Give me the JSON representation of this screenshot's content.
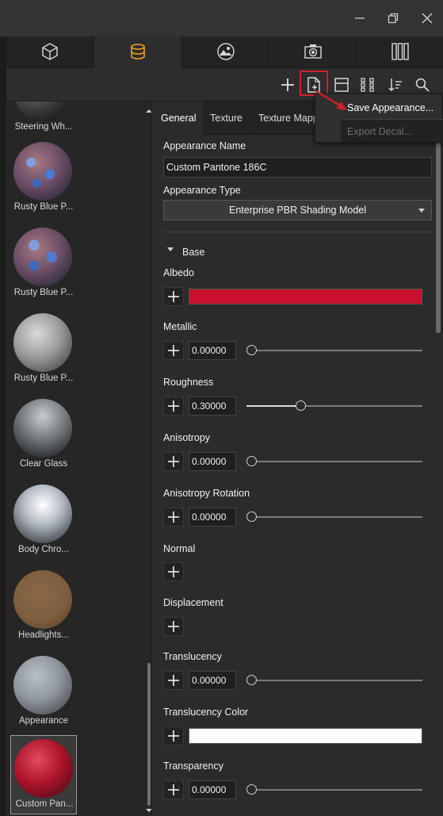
{
  "window": {
    "minimize_icon": "minimize-icon",
    "restore_icon": "restore-icon",
    "close_icon": "close-icon"
  },
  "main_tabs": [
    {
      "icon": "cube-icon",
      "active": false
    },
    {
      "icon": "appearance-library-icon",
      "active": true
    },
    {
      "icon": "environment-icon",
      "active": false
    },
    {
      "icon": "camera-icon",
      "active": false
    },
    {
      "icon": "columns-icon",
      "active": false
    }
  ],
  "toolbar": {
    "icons": [
      "add-icon",
      "new-appearance-file-icon",
      "layout-icon",
      "grid-icon",
      "sort-icon",
      "search-icon"
    ],
    "highlight_color": "#d01f2a"
  },
  "popup_menu": {
    "save_label": "Save Appearance...",
    "export_label": "Export Decal..."
  },
  "library": {
    "items": [
      {
        "label": "Steering Wh...",
        "color": "#4a4a4a"
      },
      {
        "label": "Rusty Blue P...",
        "color": "#4f6fb0"
      },
      {
        "label": "Rusty Blue P...",
        "color": "#4f6fb0"
      },
      {
        "label": "Rusty Blue P...",
        "color": "#9a9d9c"
      },
      {
        "label": "Clear Glass",
        "color": "#6b6f72"
      },
      {
        "label": "Body Chro...",
        "color": "#c8ccd0"
      },
      {
        "label": "Headlights...",
        "color": "#7b5c3c"
      },
      {
        "label": "Appearance",
        "color": "#8f969d"
      },
      {
        "label": "Custom Pan...",
        "color": "#b0152b"
      }
    ]
  },
  "properties": {
    "tabs": [
      "General",
      "Texture",
      "Texture Mapp"
    ],
    "appearance_name_label": "Appearance Name",
    "appearance_name_value": "Custom Pantone 186C",
    "appearance_type_label": "Appearance Type",
    "appearance_type_value": "Enterprise PBR Shading Model",
    "section_base": "Base",
    "albedo_label": "Albedo",
    "albedo_color": "#c8102e",
    "metallic_label": "Metallic",
    "metallic_value": "0.00000",
    "roughness_label": "Roughness",
    "roughness_value": "0.30000",
    "anisotropy_label": "Anisotropy",
    "anisotropy_value": "0.00000",
    "anisotropy_rotation_label": "Anisotropy Rotation",
    "anisotropy_rotation_value": "0.00000",
    "normal_label": "Normal",
    "displacement_label": "Displacement",
    "translucency_label": "Translucency",
    "translucency_value": "0.00000",
    "translucency_color_label": "Translucency Color",
    "translucency_color": "#ffffff",
    "transparency_label": "Transparency",
    "transparency_value": "0.00000"
  }
}
